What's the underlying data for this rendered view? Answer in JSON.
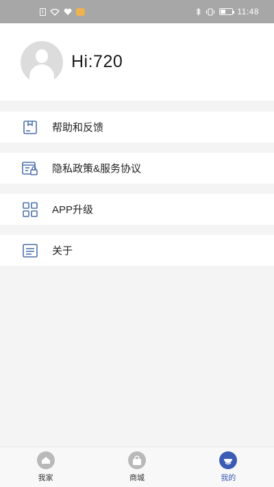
{
  "status_bar": {
    "sim_label": "1",
    "time": "11:48",
    "battery_level": 0.45,
    "icons": [
      "sim-icon",
      "wifi-icon",
      "heart-icon",
      "notification-icon",
      "bluetooth-icon",
      "vibrate-icon",
      "battery-icon"
    ]
  },
  "profile": {
    "greeting": "Hi:720"
  },
  "menu": {
    "items": [
      {
        "label": "帮助和反馈",
        "icon": "feedback-icon"
      },
      {
        "label": "隐私政策&服务协议",
        "icon": "privacy-policy-icon"
      },
      {
        "label": "APP升级",
        "icon": "grid-icon"
      },
      {
        "label": "关于",
        "icon": "about-icon"
      }
    ]
  },
  "tabs": [
    {
      "label": "我家",
      "icon": "home-icon",
      "active": false
    },
    {
      "label": "商城",
      "icon": "shopping-bag-icon",
      "active": false
    },
    {
      "label": "我的",
      "icon": "profile-icon",
      "active": true
    }
  ],
  "colors": {
    "status_bar_bg": "#a7a7a7",
    "page_bg": "#f4f4f4",
    "icon_blue": "#4a6fa8",
    "active_tab": "#3b5bb5"
  }
}
